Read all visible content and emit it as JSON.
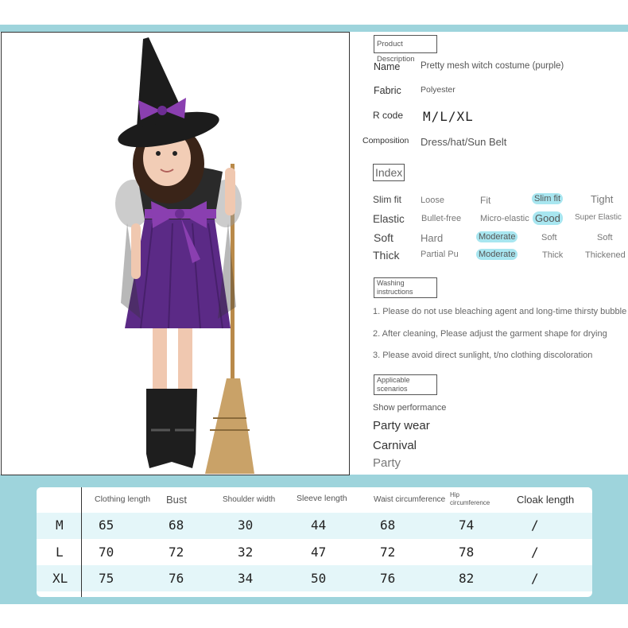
{
  "product": {
    "header": "Product Description",
    "fields": [
      {
        "label": "Name",
        "value": "Pretty mesh witch costume (purple)"
      },
      {
        "label": "Fabric",
        "value": "Polyester"
      },
      {
        "label": "R code",
        "value": "M/L/XL"
      },
      {
        "label": "Composition",
        "value": "Dress/hat/Sun Belt"
      }
    ]
  },
  "index": {
    "header": "Index",
    "rows": [
      {
        "key": "Slim fit",
        "options": [
          "Loose",
          "Fit",
          "Slim fit",
          "Tight"
        ],
        "selected": 2
      },
      {
        "key": "Elastic",
        "options": [
          "Bullet-free",
          "Micro-elastic",
          "Good",
          "Super Elastic"
        ],
        "selected": 2
      },
      {
        "key": "Soft",
        "options": [
          "Hard",
          "Moderate",
          "Soft",
          "Soft"
        ],
        "selected": 1
      },
      {
        "key": "Thick",
        "options": [
          "Partial Pu",
          "Moderate",
          "Thick",
          "Thickened"
        ],
        "selected": 1
      }
    ]
  },
  "washing": {
    "header": "Washing instructions",
    "items": [
      "1. Please do not use bleaching agent and long-time thirsty bubble",
      "2. After cleaning, Please adjust the garment shape for drying",
      "3. Please avoid direct sunlight, t/no clothing discoloration"
    ]
  },
  "scenarios": {
    "header": "Applicable scenarios",
    "items": [
      "Show performance",
      "Party wear",
      "Carnival",
      "Party"
    ]
  },
  "size_table": {
    "headers": [
      "Clothing length",
      "Bust",
      "Shoulder width",
      "Sleeve length",
      "Waist circumference",
      "Hip circumference",
      "Cloak length"
    ],
    "rows": [
      {
        "size": "M",
        "values": [
          "65",
          "68",
          "30",
          "44",
          "68",
          "74",
          "/"
        ]
      },
      {
        "size": "L",
        "values": [
          "70",
          "72",
          "32",
          "47",
          "72",
          "78",
          "/"
        ]
      },
      {
        "size": "XL",
        "values": [
          "75",
          "76",
          "34",
          "50",
          "76",
          "82",
          "/"
        ]
      }
    ]
  },
  "colors": {
    "band": "#9ed4dc",
    "highlight": "#a8e6f0",
    "row_alt": "#e4f6f9",
    "dress_purple": "#5b2a86",
    "hat_black": "#1c1c1c",
    "bow": "#8a3fb0"
  }
}
